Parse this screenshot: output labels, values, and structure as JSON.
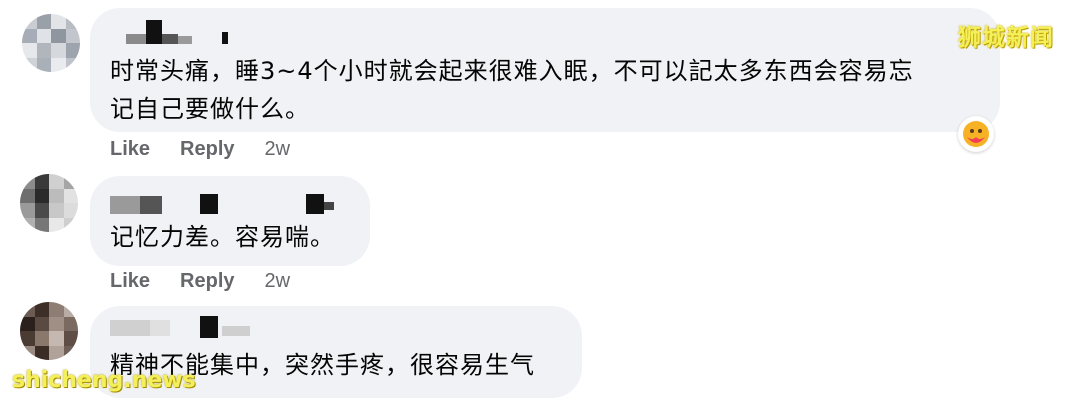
{
  "comments": [
    {
      "text_lines": [
        "时常头痛，睡3~4个小时就会起来很难入眠，不可以記太多东西会容易忘",
        "记自己要做什么。"
      ],
      "like_label": "Like",
      "reply_label": "Reply",
      "time": "2w",
      "reaction_icon": "care-reaction-icon"
    },
    {
      "text_lines": [
        "记忆力差。容易喘。"
      ],
      "like_label": "Like",
      "reply_label": "Reply",
      "time": "2w"
    },
    {
      "text_lines": [
        "精神不能集中，突然手疼，很容易生气"
      ]
    }
  ],
  "watermarks": {
    "top_right": "狮城新闻",
    "bottom_left": "shicheng.news"
  },
  "colors": {
    "bubble_bg": "#f0f2f5",
    "action_text": "#65676b",
    "watermark": "#f3f05a"
  }
}
